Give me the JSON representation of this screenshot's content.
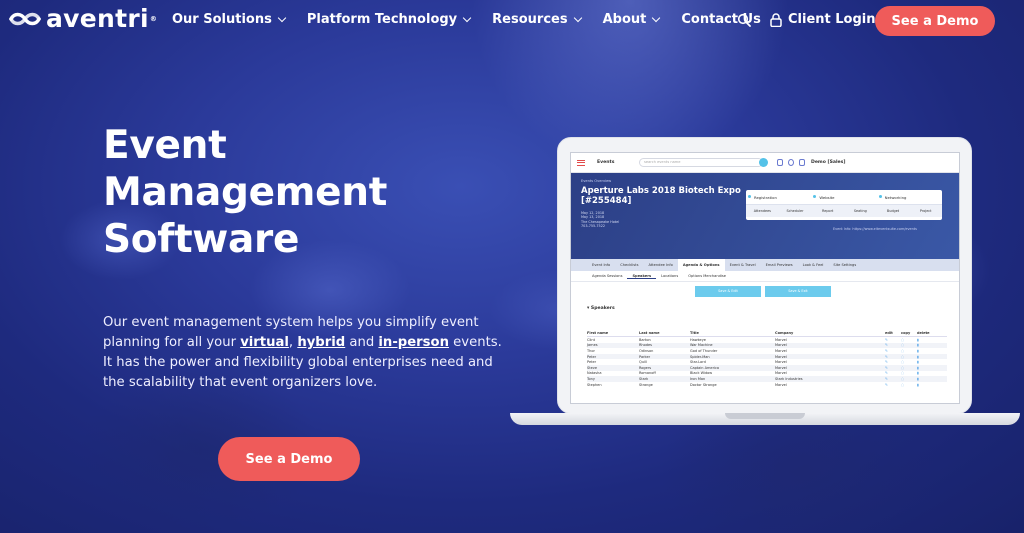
{
  "brand": {
    "name": "aventri",
    "tm": "®"
  },
  "nav": {
    "items": [
      {
        "label": "Our Solutions",
        "dropdown": true
      },
      {
        "label": "Platform Technology",
        "dropdown": true
      },
      {
        "label": "Resources",
        "dropdown": true
      },
      {
        "label": "About",
        "dropdown": true
      },
      {
        "label": "Contact Us",
        "dropdown": false
      }
    ],
    "login": "Client Login",
    "cta": "See a Demo"
  },
  "hero": {
    "title_lines": [
      "Event",
      "Management",
      "Software"
    ],
    "lead_pre": "Our event management system helps you simplify event planning for all your ",
    "lead_virtual": "virtual",
    "lead_comma": ", ",
    "lead_hybrid": "hybrid",
    "lead_and": " and ",
    "lead_inperson": "in-person",
    "lead_post": " events. It has the power and flexibility global enterprises need and the scalability that event organizers love.",
    "cta": "See a Demo"
  },
  "app": {
    "events_label": "Events",
    "search_placeholder": "search events name",
    "demo_label": "Demo [Sales]",
    "crumb": "Events Overview",
    "event_title": "Aperture Labs 2018 Biotech Expo [#255484]",
    "event_meta": [
      "May 12, 2018",
      "May 13, 2018",
      "The Chesapeake Hotel",
      "703-755-7522"
    ],
    "panel_top": [
      "Registration",
      "Website",
      "Networking"
    ],
    "panel_bottom": [
      "Attendees",
      "Scheduler",
      "Report",
      "Seating",
      "Budget",
      "Project"
    ],
    "event_link": "Event Info: https://www.eiteventsuite.com/events",
    "tabs": [
      "Event Info",
      "Checklists",
      "Attendee Info",
      "Agenda & Options",
      "Event & Travel",
      "Email Previews",
      "Look & Feel",
      "Site Settings"
    ],
    "active_tab": "Agenda & Options",
    "subtabs": [
      "Agenda Sessions",
      "Speakers",
      "Locations",
      "Options Merchandise"
    ],
    "active_subtab": "Speakers",
    "buttons": [
      "Save & Edit",
      "Save & Exit"
    ],
    "section": "Speakers",
    "table": {
      "headers": [
        "First name",
        "Last name",
        "Title",
        "Company",
        "edit",
        "copy",
        "delete"
      ],
      "rows": [
        [
          "Clint",
          "Barton",
          "Hawkeye",
          "Marvel"
        ],
        [
          "James",
          "Rhodes",
          "War Machine",
          "Marvel"
        ],
        [
          "Thor",
          "Odinson",
          "God of Thunder",
          "Marvel"
        ],
        [
          "Peter",
          "Parker",
          "Spider-Man",
          "Marvel"
        ],
        [
          "Peter",
          "Quill",
          "Star-Lord",
          "Marvel"
        ],
        [
          "Steve",
          "Rogers",
          "Captain America",
          "Marvel"
        ],
        [
          "Natasha",
          "Romanoff",
          "Black Widow",
          "Marvel"
        ],
        [
          "Tony",
          "Stark",
          "Iron Man",
          "Stark Industries"
        ],
        [
          "Stephen",
          "Strange",
          "Doctor Strange",
          "Marvel"
        ]
      ]
    }
  },
  "colors": {
    "accent": "#ef5b5a",
    "bg": "#2b3a9a",
    "app_blue": "#2c3f86",
    "app_cyan": "#54c2e8"
  }
}
